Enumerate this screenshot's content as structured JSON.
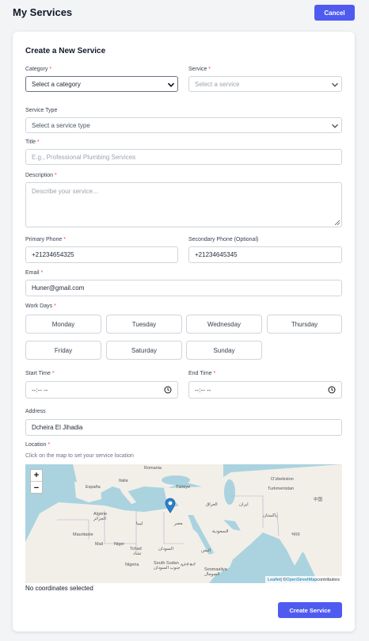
{
  "header": {
    "title": "My Services",
    "cancel_label": "Cancel"
  },
  "form": {
    "title": "Create a New Service",
    "category": {
      "label": "Category",
      "value": "Select a category"
    },
    "service": {
      "label": "Service",
      "value": "Select a service"
    },
    "service_type": {
      "label": "Service Type",
      "value": "Select a service type"
    },
    "title_field": {
      "label": "Title",
      "placeholder": "E.g., Professional Plumbing Services"
    },
    "description": {
      "label": "Description",
      "placeholder": "Describe your service..."
    },
    "primary_phone": {
      "label": "Primary Phone",
      "value": "+21234654325"
    },
    "secondary_phone": {
      "label": "Secondary Phone (Optional)",
      "value": "+21234645345"
    },
    "email": {
      "label": "Email",
      "value": "Huner@gmail.com"
    },
    "work_days": {
      "label": "Work Days",
      "days": [
        "Monday",
        "Tuesday",
        "Wednesday",
        "Thursday",
        "Friday",
        "Saturday",
        "Sunday"
      ]
    },
    "start_time": {
      "label": "Start Time",
      "value": "--:-- --"
    },
    "end_time": {
      "label": "End Time",
      "value": "--:-- --"
    },
    "address": {
      "label": "Address",
      "value": "Dcheira El Jihadia"
    },
    "location": {
      "label": "Location",
      "hint": "Click on the map to set your service location",
      "coords_text": "No coordinates selected"
    },
    "required_mark": "*",
    "submit_label": "Create Service"
  },
  "map": {
    "zoom_in": "+",
    "zoom_out": "−",
    "attribution": {
      "leaflet": "Leaflet",
      "separator": " | © ",
      "osm": "OpenStreetMap",
      "suffix": " contributors"
    },
    "labels": [
      "Romania",
      "Türkiye",
      "Turkmenistan",
      "Oʻzbekiston",
      "España",
      "Italia",
      "العراق",
      "ایران",
      "Algérie",
      "الجزائر",
      "ليبيا",
      "مصر",
      "Mauritanie",
      "Mali",
      "Niger",
      "Tchad",
      "تشاد",
      "السودان",
      "السعودية",
      "اليمن",
      "Nigeria",
      "South Sudan",
      "جنوب السودان",
      "ኢትዮጵያ",
      "Soomaaliya",
      "الصومال",
      "پاکستان",
      "भारत",
      "中国"
    ]
  },
  "colors": {
    "accent": "#4f5bf0",
    "required": "#ef4444",
    "water": "#aad3df",
    "land": "#f2efe9",
    "marker": "#2a81cb"
  }
}
